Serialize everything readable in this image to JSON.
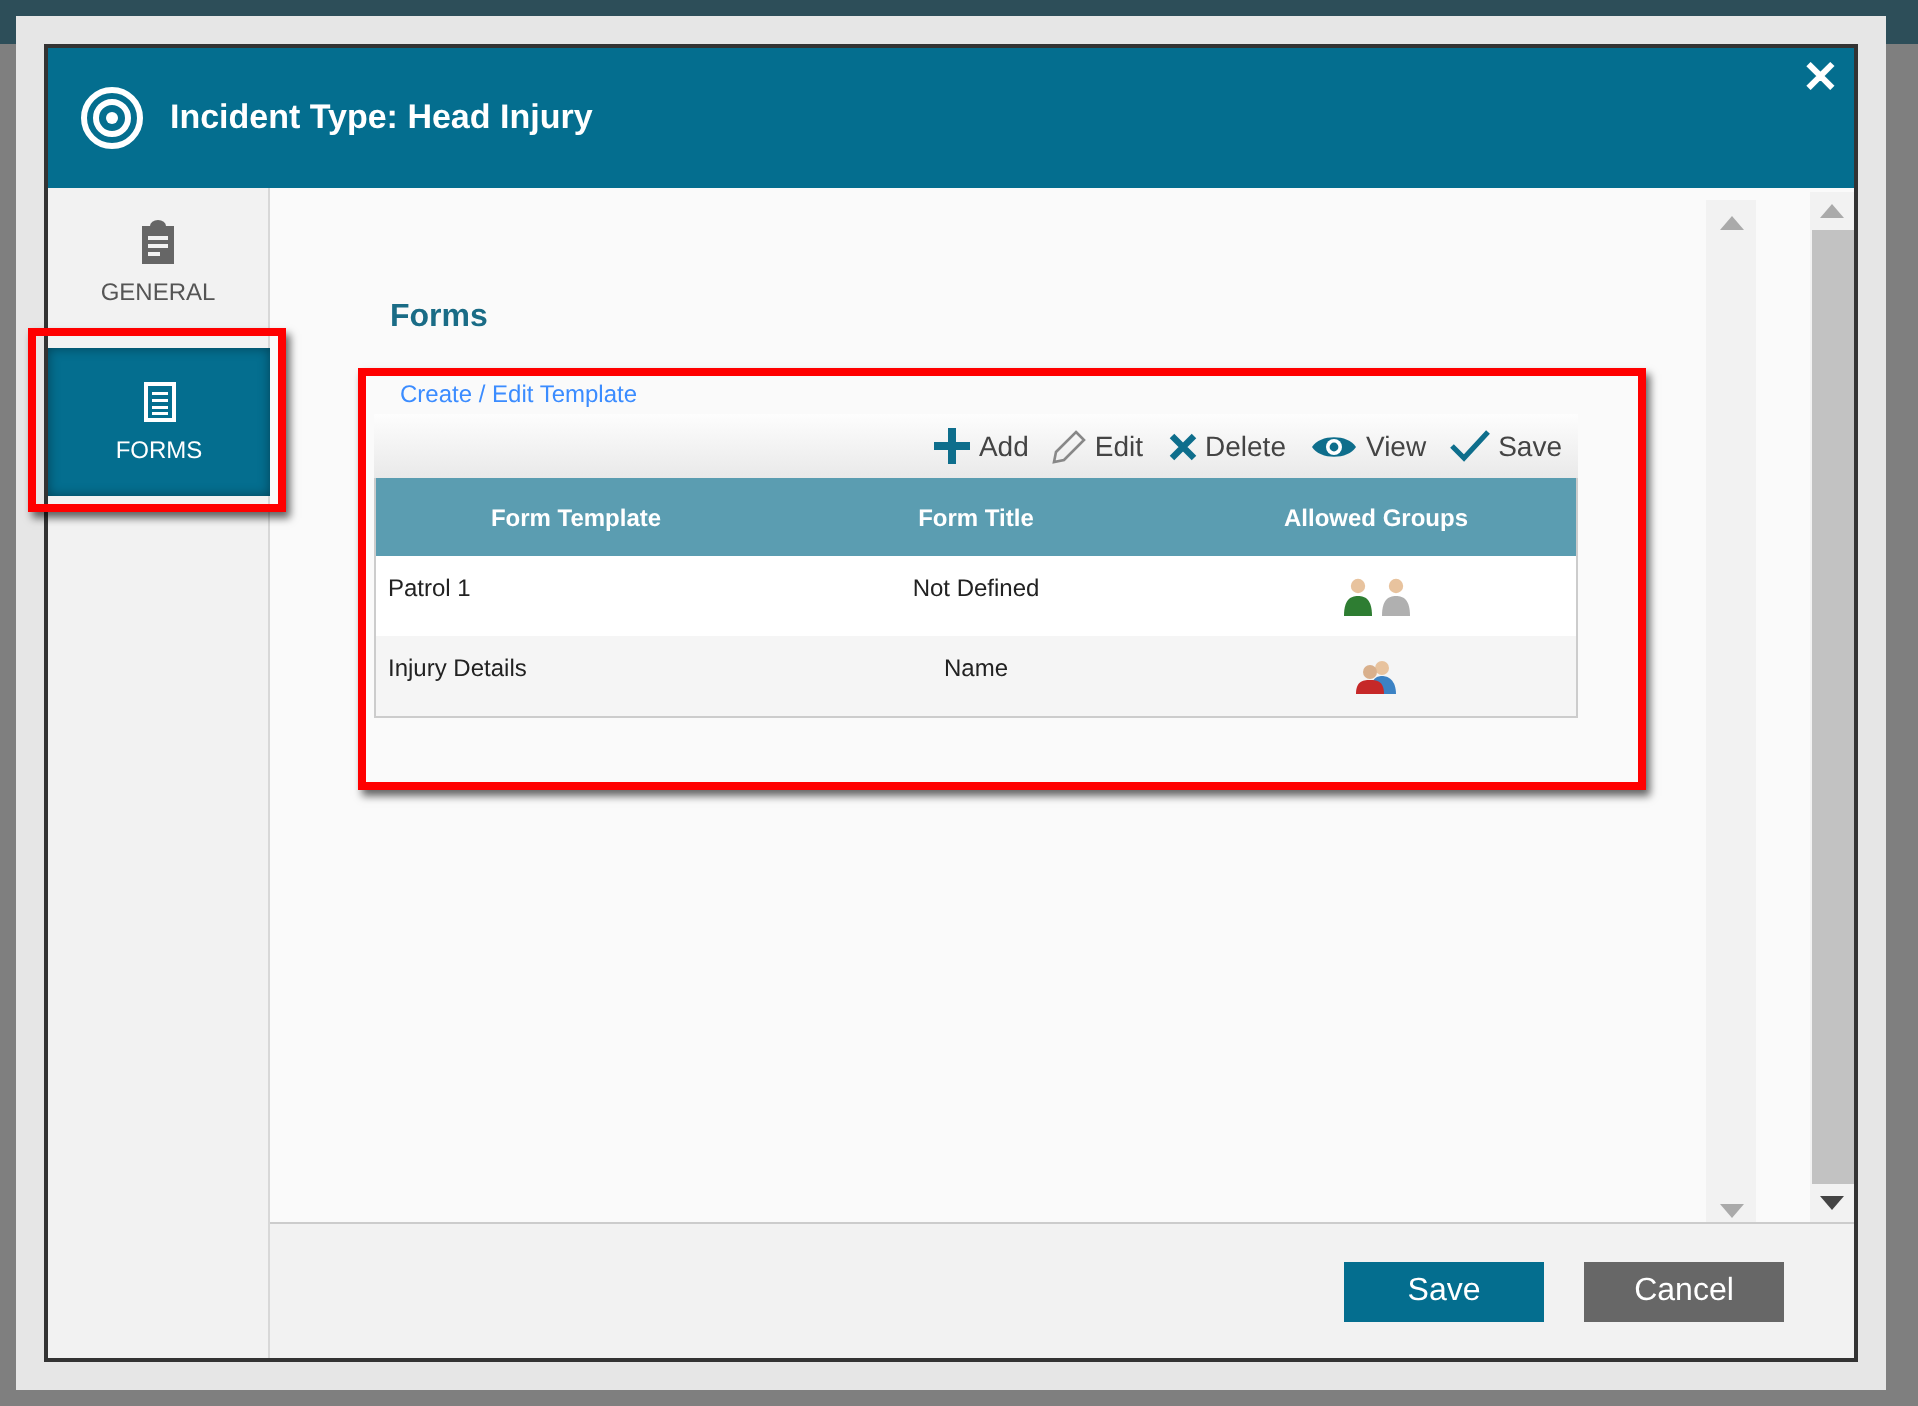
{
  "dialog": {
    "title": "Incident Type: Head Injury",
    "close": "✕"
  },
  "sidebar": {
    "items": [
      {
        "label": "GENERAL",
        "kind": "general",
        "selected": false,
        "highlighted": false
      },
      {
        "label": "FORMS",
        "kind": "forms",
        "selected": true,
        "highlighted": true
      }
    ]
  },
  "forms": {
    "heading": "Forms",
    "highlighted": true,
    "link": "Create / Edit Template",
    "toolbar": [
      {
        "label": "Add",
        "kind": "add"
      },
      {
        "label": "Edit",
        "kind": "edit"
      },
      {
        "label": "Delete",
        "kind": "delete"
      },
      {
        "label": "View",
        "kind": "view"
      },
      {
        "label": "Save",
        "kind": "save"
      }
    ],
    "columns": [
      "Form Template",
      "Form Title",
      "Allowed Groups"
    ],
    "rows": [
      {
        "template": "Patrol 1",
        "title": "Not Defined",
        "groups": [
          {
            "kind": "single",
            "color": "#2e7d32"
          },
          {
            "kind": "single",
            "color": "#b0b0b0"
          }
        ]
      },
      {
        "template": "Injury Details",
        "title": "Name",
        "groups": [
          {
            "kind": "pair",
            "color": "#c62828"
          }
        ]
      }
    ]
  },
  "footer": {
    "buttons": [
      {
        "label": "Save",
        "kind": "primary"
      },
      {
        "label": "Cancel",
        "kind": "secondary"
      }
    ]
  }
}
